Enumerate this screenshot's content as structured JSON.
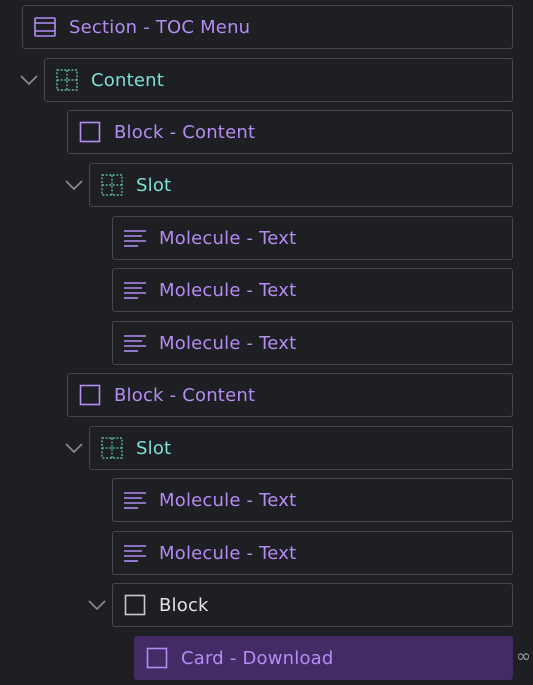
{
  "tree": [
    {
      "label": "Section - TOC Menu",
      "icon": "section-icon",
      "color": "purple",
      "expanded": null
    },
    {
      "label": "Content",
      "icon": "grid-layout-icon",
      "color": "teal",
      "expanded": true
    },
    {
      "label": "Block - Content",
      "icon": "block-square-icon",
      "color": "purple",
      "expanded": null
    },
    {
      "label": "Slot",
      "icon": "grid-layout-icon",
      "color": "teal",
      "expanded": true
    },
    {
      "label": "Molecule - Text",
      "icon": "text-lines-icon",
      "color": "purple",
      "expanded": null
    },
    {
      "label": "Molecule - Text",
      "icon": "text-lines-icon",
      "color": "purple",
      "expanded": null
    },
    {
      "label": "Molecule - Text",
      "icon": "text-lines-icon",
      "color": "purple",
      "expanded": null
    },
    {
      "label": "Block - Content",
      "icon": "block-square-icon",
      "color": "purple",
      "expanded": null
    },
    {
      "label": "Slot",
      "icon": "grid-layout-icon",
      "color": "teal",
      "expanded": true
    },
    {
      "label": "Molecule - Text",
      "icon": "text-lines-icon",
      "color": "purple",
      "expanded": null
    },
    {
      "label": "Molecule - Text",
      "icon": "text-lines-icon",
      "color": "purple",
      "expanded": null
    },
    {
      "label": "Block",
      "icon": "block-square-icon",
      "color": "white",
      "expanded": true
    },
    {
      "label": "Card - Download",
      "icon": "block-square-icon",
      "color": "purple",
      "expanded": null,
      "selected": true
    }
  ],
  "colors": {
    "background": "#1e1f22",
    "border": "#45474d",
    "purple": "#b48cf4",
    "teal": "#7ee0d4",
    "white": "#e4e4e6",
    "selected_bg": "#432c66"
  },
  "side_icon": "link-icon"
}
